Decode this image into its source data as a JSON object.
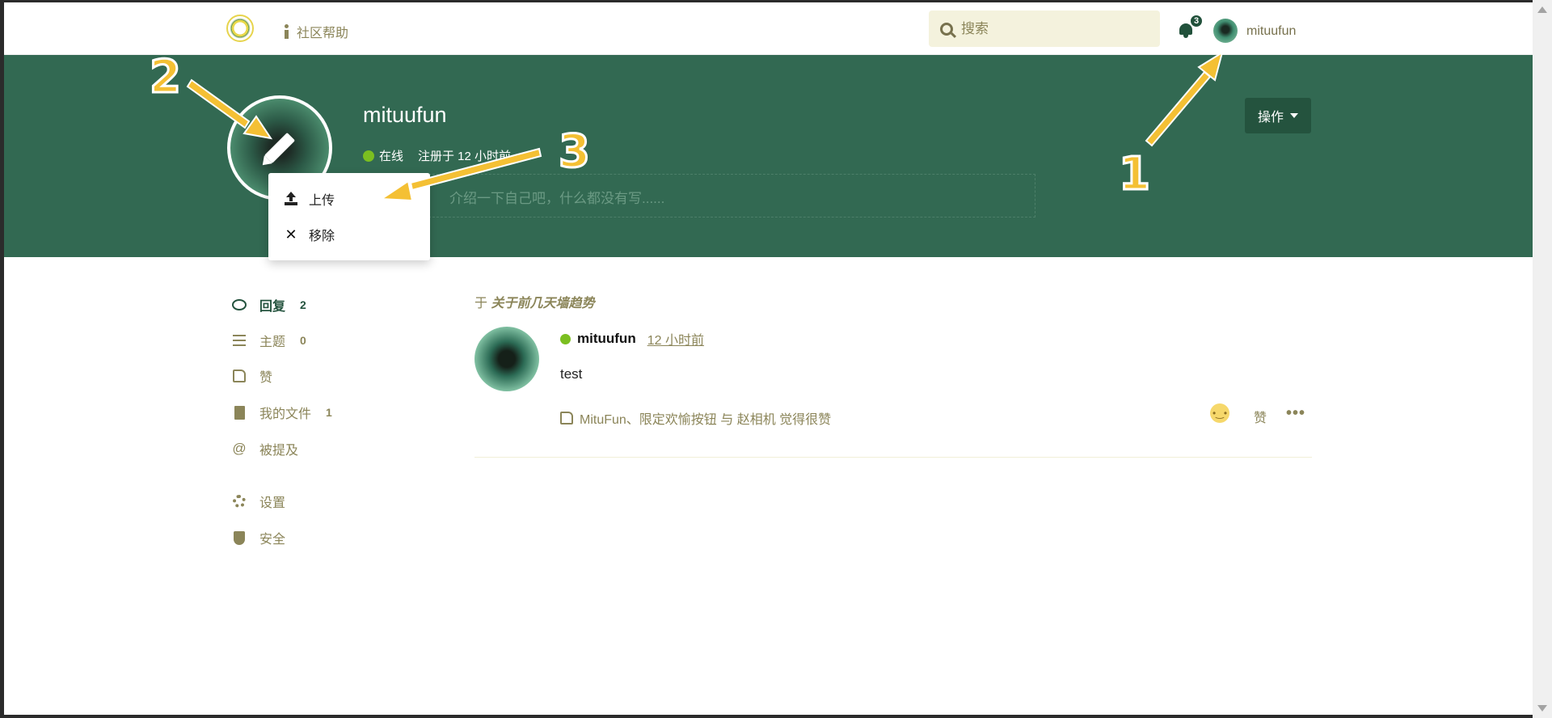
{
  "header": {
    "help_label": "社区帮助",
    "search_placeholder": "搜索",
    "notification_count": "3",
    "username": "mituufun"
  },
  "profile": {
    "name": "mituufun",
    "status": "在线",
    "joined": "注册于 12 小时前",
    "bio_placeholder": "介绍一下自己吧，什么都没有写......",
    "actions_label": "操作"
  },
  "avatar_menu": {
    "upload_label": "上传",
    "remove_label": "移除"
  },
  "sidebar": {
    "items": [
      {
        "label": "回复",
        "count": "2",
        "icon": "comment-icon"
      },
      {
        "label": "主题",
        "count": "0",
        "icon": "list-icon"
      },
      {
        "label": "赞",
        "count": "",
        "icon": "thumbs-up-icon"
      },
      {
        "label": "我的文件",
        "count": "1",
        "icon": "file-icon"
      },
      {
        "label": "被提及",
        "count": "",
        "icon": "at-icon"
      },
      {
        "label": "设置",
        "count": "",
        "icon": "gear-icon"
      },
      {
        "label": "安全",
        "count": "",
        "icon": "shield-icon"
      }
    ]
  },
  "post": {
    "context_prefix": "于",
    "discussion_title": "关于前几天墙趋势",
    "author": "mituufun",
    "time": "12 小时前",
    "body": "test",
    "likes_text": "MituFun、限定欢愉按钮 与 赵相机 觉得很赞",
    "like_button": "赞",
    "more": "•••"
  },
  "annotations": {
    "one": "1",
    "two": "2",
    "three": "3"
  },
  "colors": {
    "hero_bg": "#326952",
    "accent": "#24533e",
    "muted_text": "#8b8559",
    "annotation": "#f4c034",
    "online": "#7bbf20"
  }
}
